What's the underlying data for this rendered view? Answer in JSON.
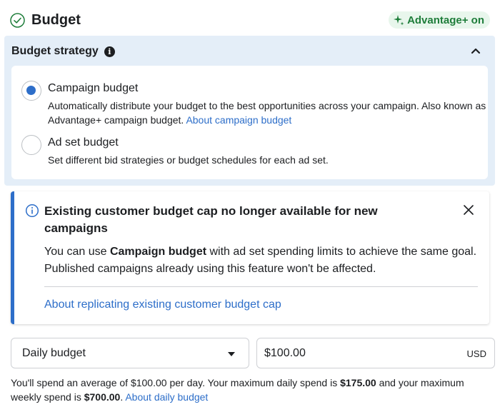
{
  "header": {
    "title": "Budget",
    "advantage_badge": "Advantage+ on"
  },
  "strategy": {
    "heading": "Budget strategy",
    "options": [
      {
        "label": "Campaign budget",
        "selected": true,
        "description": "Automatically distribute your budget to the best opportunities across your campaign. Also known as Advantage+ campaign budget.",
        "link": "About campaign budget"
      },
      {
        "label": "Ad set budget",
        "selected": false,
        "description": "Set different bid strategies or budget schedules for each ad set."
      }
    ]
  },
  "notice": {
    "title": "Existing customer budget cap no longer available for new campaigns",
    "body_prefix": "You can use ",
    "body_bold": "Campaign budget",
    "body_suffix": " with ad set spending limits to achieve the same goal. Published campaigns already using this feature won't be affected.",
    "link": "About replicating existing customer budget cap"
  },
  "budget": {
    "type_selected": "Daily budget",
    "amount_value": "$100.00",
    "currency": "USD"
  },
  "spend_info": {
    "part1": "You'll spend an average of $100.00 per day. Your maximum daily spend is ",
    "max_daily": "$175.00",
    "part2": " and your maximum weekly spend is ",
    "max_weekly": "$700.00",
    "part3": ". ",
    "link": "About daily budget"
  },
  "colors": {
    "accent_blue": "#2d6ec9",
    "advantage_green": "#1e7d3a",
    "strategy_bg": "#e4eef8"
  }
}
